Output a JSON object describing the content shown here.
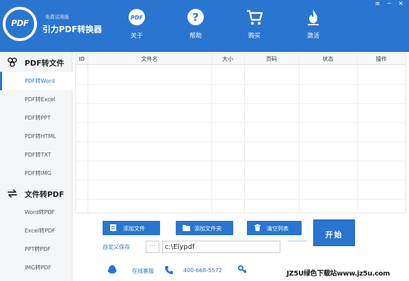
{
  "header": {
    "logo_text": "PDF",
    "trial_label": "免费试用版",
    "app_title": "引力PDF转换器",
    "nav": [
      {
        "label": "关于",
        "icon": "pdf-badge-icon"
      },
      {
        "label": "帮助",
        "icon": "help-icon"
      },
      {
        "label": "购买",
        "icon": "cart-icon"
      },
      {
        "label": "激活",
        "icon": "flame-icon"
      }
    ],
    "window_controls": [
      "≡",
      "─",
      "✕"
    ]
  },
  "sidebar": {
    "sections": [
      {
        "title": "PDF转文件",
        "icon": "convert-icon",
        "items": [
          "PDF转Word",
          "PDF转Excel",
          "PDF转PPT",
          "PDF转HTML",
          "PDF转TXT",
          "PDF转IMG"
        ]
      },
      {
        "title": "文件转PDF",
        "icon": "swap-icon",
        "items": [
          "Word转PDF",
          "Excel转PDF",
          "PPT转PDF",
          "IMG转PDF"
        ]
      }
    ],
    "active_item": "PDF转Word"
  },
  "table": {
    "columns": [
      "ID",
      "文件名",
      "大小",
      "页码",
      "状态",
      "操作"
    ],
    "rows": []
  },
  "actions": {
    "add_file": "添加文件",
    "add_folder": "添加文件夹",
    "clear_list": "清空列表",
    "start": "开始"
  },
  "save": {
    "label": "自定义保存",
    "browse": "···",
    "path": "c:\\Elypdf"
  },
  "footer": {
    "service_label": "在线客服",
    "phone": "400-668-5572",
    "watermark": "JZ5U绿色下载站www.jz5u.com"
  },
  "colors": {
    "accent": "#2a75d0",
    "sidebar_bg": "#f4f5f7"
  }
}
